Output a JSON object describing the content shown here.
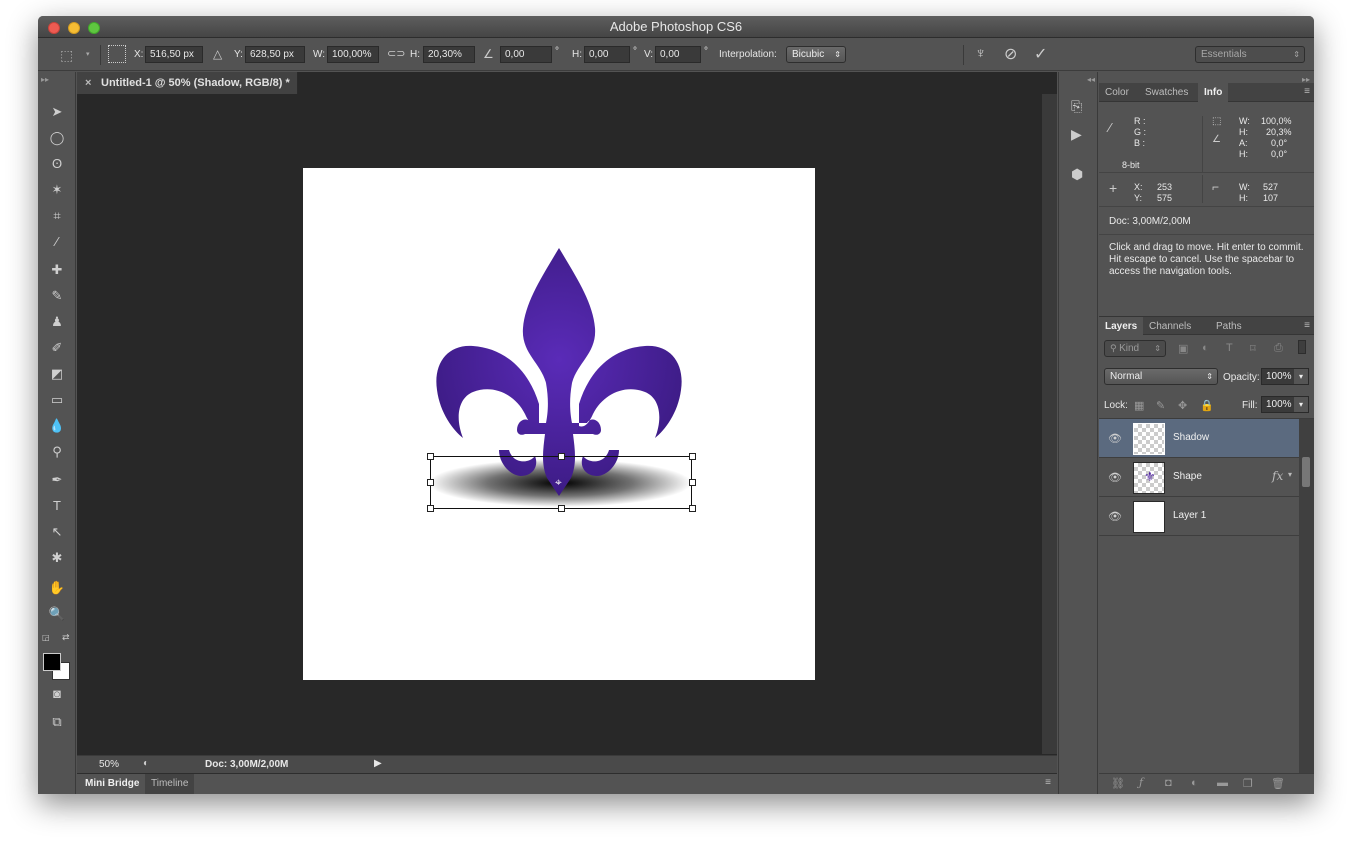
{
  "app": {
    "title": "Adobe Photoshop CS6"
  },
  "options": {
    "x_label": "X:",
    "x_value": "516,50 px",
    "y_label": "Y:",
    "y_value": "628,50 px",
    "w_label": "W:",
    "w_value": "100,00%",
    "h_label": "H:",
    "h_value": "20,30%",
    "angle_value": "0,00",
    "hskew_label": "H:",
    "hskew_value": "0,00",
    "vskew_label": "V:",
    "vskew_value": "0,00",
    "degree": "°",
    "interp_label": "Interpolation:",
    "interp_value": "Bicubic",
    "workspace": "Essentials"
  },
  "document": {
    "tab_title": "Untitled-1 @ 50% (Shadow, RGB/8) *"
  },
  "status": {
    "zoom": "50%",
    "doc_info": "Doc: 3,00M/2,00M"
  },
  "bottom_tabs": [
    "Mini Bridge",
    "Timeline"
  ],
  "info_panel": {
    "tabs": [
      "Color",
      "Swatches",
      "Info"
    ],
    "r_label": "R :",
    "g_label": "G :",
    "b_label": "B :",
    "bit_depth": "8-bit",
    "w_label": "W:",
    "w_pct": "100,0%",
    "h_label": "H:",
    "h_pct": "20,3%",
    "a_label": "A:",
    "a_val": "0,0°",
    "h2_label": "H:",
    "h2_val": "0,0°",
    "x_label": "X:",
    "x_val": "253",
    "y_label": "Y:",
    "y_val": "575",
    "w2_label": "W:",
    "w2_val": "527",
    "h3_label": "H:",
    "h3_val": "107",
    "doc": "Doc: 3,00M/2,00M",
    "hint": "Click and drag to move. Hit enter to commit. Hit escape to cancel. Use the spacebar to access the navigation tools."
  },
  "layers_panel": {
    "tabs": [
      "Layers",
      "Channels",
      "Paths"
    ],
    "kind": "Kind",
    "blend_mode": "Normal",
    "opacity_label": "Opacity:",
    "opacity": "100%",
    "lock_label": "Lock:",
    "fill_label": "Fill:",
    "fill": "100%",
    "fx": "fx",
    "layers": [
      {
        "name": "Shadow",
        "selected": true
      },
      {
        "name": "Shape",
        "selected": false
      },
      {
        "name": "Layer 1",
        "selected": false
      }
    ]
  },
  "colors": {
    "accent_selected": "#5b6a7f",
    "shape_purple": "#4a1d9e"
  }
}
